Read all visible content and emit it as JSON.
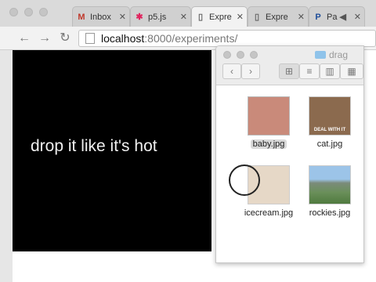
{
  "browser": {
    "tabs": [
      {
        "icon": "gmail-icon",
        "glyph": "M",
        "glyph_color": "#c0392b",
        "label": "Inbox"
      },
      {
        "icon": "p5js-icon",
        "glyph": "✱",
        "glyph_color": "#e0245e",
        "label": "p5.js"
      },
      {
        "icon": "page-icon",
        "glyph": "▯",
        "glyph_color": "#666",
        "label": "Expre"
      },
      {
        "icon": "page-icon",
        "glyph": "▯",
        "glyph_color": "#666",
        "label": "Expre"
      },
      {
        "icon": "paypal-icon",
        "glyph": "P",
        "glyph_color": "#1f4e9a",
        "label": "Pa"
      }
    ],
    "tab_close": "✕",
    "url_host": "localhost",
    "url_path": ":8000/experiments/"
  },
  "canvas": {
    "message": "drop it like it's hot"
  },
  "finder": {
    "folder": "drag",
    "files": [
      {
        "name": "baby.jpg",
        "selected": true,
        "color": "#c98a7a"
      },
      {
        "name": "cat.jpg",
        "selected": false,
        "color": "#8b6a4e",
        "caption": "DEAL WITH IT"
      },
      {
        "name": "icecream.jpg",
        "selected": false,
        "color": "#e6d8c7"
      },
      {
        "name": "rockies.jpg",
        "selected": false,
        "color": "#6a8f5a"
      }
    ]
  }
}
